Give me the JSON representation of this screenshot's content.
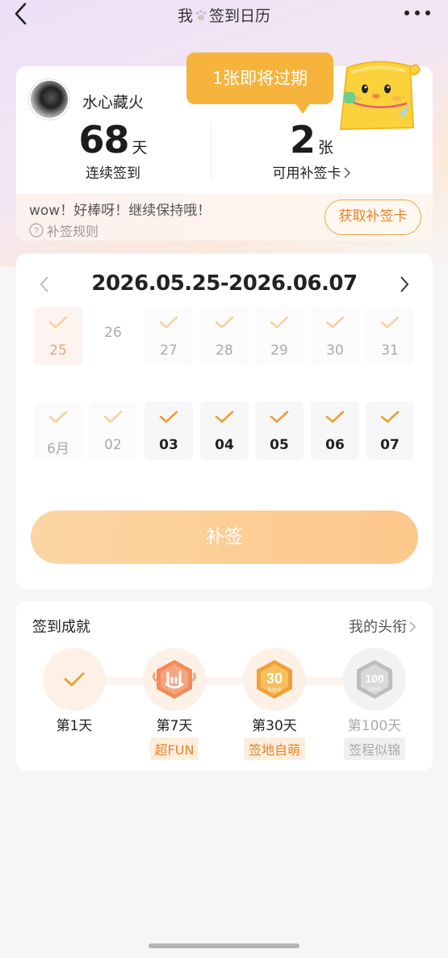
{
  "nav": {
    "title_pre": "我",
    "title_post": "签到日历",
    "paw_icon": "paw-icon",
    "more_icon": "more-dots-icon"
  },
  "profile": {
    "username": "水心藏火",
    "streak_days": "68",
    "streak_unit": "天",
    "streak_label": "连续签到",
    "cards_count": "2",
    "cards_unit": "张",
    "cards_label": "可用补签卡",
    "encourage": "wow！好棒呀！继续保持哦！",
    "rules_label": "补签规则",
    "get_card_label": "获取补签卡"
  },
  "tooltip": {
    "text": "1张即将过期"
  },
  "calendar": {
    "range": "2026.05.25-2026.06.07",
    "days": [
      {
        "label": "25",
        "state": "today",
        "checked": true
      },
      {
        "label": "26",
        "state": "missed",
        "checked": false
      },
      {
        "label": "27",
        "state": "faded",
        "checked": true
      },
      {
        "label": "28",
        "state": "faded",
        "checked": true
      },
      {
        "label": "29",
        "state": "faded",
        "checked": true
      },
      {
        "label": "30",
        "state": "faded",
        "checked": true
      },
      {
        "label": "31",
        "state": "faded",
        "checked": true
      },
      {
        "label": "6月",
        "state": "faded",
        "checked": true
      },
      {
        "label": "02",
        "state": "faded",
        "checked": true
      },
      {
        "label": "03",
        "state": "active",
        "checked": true
      },
      {
        "label": "04",
        "state": "active",
        "checked": true
      },
      {
        "label": "05",
        "state": "active",
        "checked": true
      },
      {
        "label": "06",
        "state": "active",
        "checked": true
      },
      {
        "label": "07",
        "state": "active",
        "checked": true
      }
    ],
    "resign_label": "补签"
  },
  "achievements": {
    "title": "签到成就",
    "link_label": "我的头衔",
    "items": [
      {
        "day": "第1天",
        "badge": "",
        "icon": "check-icon",
        "unlocked": true
      },
      {
        "day": "第7天",
        "badge": "超FUN",
        "icon": "rock-hand-badge-icon",
        "unlocked": true
      },
      {
        "day": "第30天",
        "badge": "签地自萌",
        "icon": "30-days-badge-icon",
        "badge_art_text": "30 DAYS",
        "unlocked": true
      },
      {
        "day": "第100天",
        "badge": "签程似锦",
        "icon": "100-days-badge-icon",
        "badge_art_text": "100 DAYS",
        "unlocked": false
      }
    ]
  },
  "colors": {
    "accent": "#f6b43c",
    "orange_text": "#e7852a",
    "check": "#e9a03a"
  }
}
